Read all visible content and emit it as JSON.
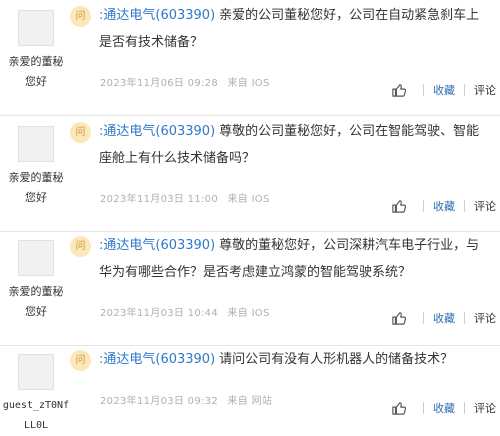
{
  "actions": {
    "favorite": "收藏",
    "comment": "评论"
  },
  "items": [
    {
      "user_line1": "亲爱的董秘",
      "user_line2": "您好",
      "badge": "问",
      "company": ":通达电气(603390)",
      "question": "亲爱的公司董秘您好，公司在自动紧急刹车上是否有技术储备？",
      "date": "2023年11月06日 09:28",
      "source": "来自 IOS"
    },
    {
      "user_line1": "亲爱的董秘",
      "user_line2": "您好",
      "badge": "问",
      "company": ":通达电气(603390)",
      "question": "尊敬的公司董秘您好，公司在智能驾驶、智能座舱上有什么技术储备吗？",
      "date": "2023年11月03日 11:00",
      "source": "来自 IOS"
    },
    {
      "user_line1": "亲爱的董秘",
      "user_line2": "您好",
      "badge": "问",
      "company": ":通达电气(603390)",
      "question": "尊敬的董秘您好，公司深耕汽车电子行业，与华为有哪些合作？是否考虑建立鸿蒙的智能驾驶系统？",
      "date": "2023年11月03日 10:44",
      "source": "来自 IOS"
    },
    {
      "user_line1": "guest_zT0Nf",
      "user_line2": "LL0L",
      "badge": "问",
      "company": ":通达电气(603390)",
      "question": "请问公司有没有人形机器人的储备技术？",
      "date": "2023年11月03日 09:32",
      "source": "来自 网站"
    }
  ]
}
